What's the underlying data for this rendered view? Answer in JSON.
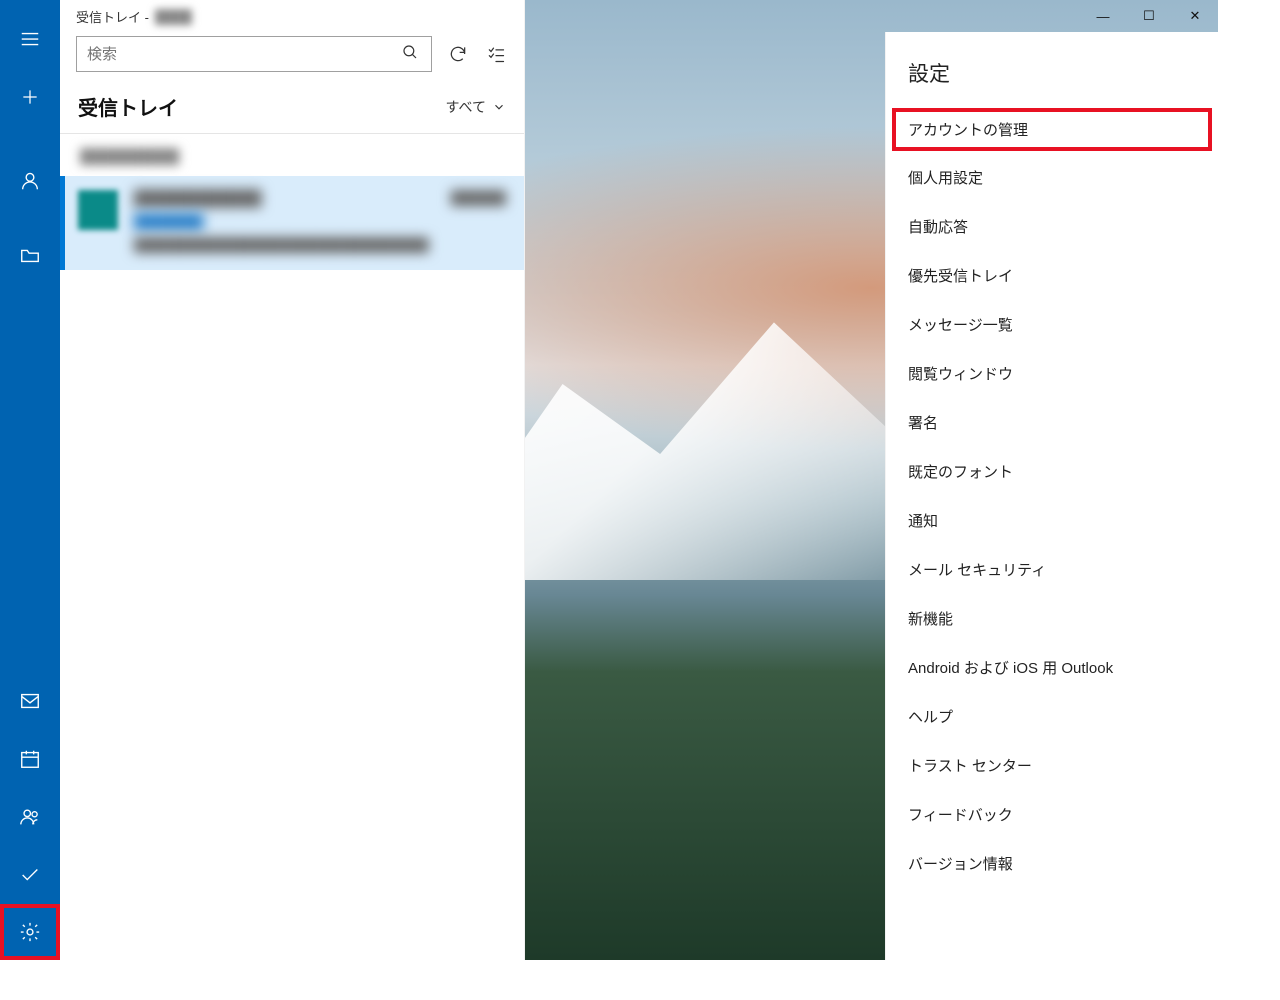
{
  "rail": {
    "items": [
      "menu",
      "compose",
      "account",
      "folder",
      "",
      "mail",
      "calendar",
      "people",
      "todo",
      "settings"
    ]
  },
  "titlebar": {
    "prefix": "受信トレイ -",
    "account": "████"
  },
  "search": {
    "placeholder": "検索"
  },
  "inbox": {
    "heading": "受信トレイ",
    "filter_label": "すべて"
  },
  "group": {
    "label": "██████████"
  },
  "mail": {
    "sender": "████████████",
    "date": "██████",
    "subject": "███████",
    "preview": "████████████████████████████████"
  },
  "window": {
    "minimize": "—",
    "maximize": "☐",
    "close": "✕"
  },
  "settings": {
    "title": "設定",
    "items": [
      "アカウントの管理",
      "個人用設定",
      "自動応答",
      "優先受信トレイ",
      "メッセージ一覧",
      "閲覧ウィンドウ",
      "署名",
      "既定のフォント",
      "通知",
      "メール セキュリティ",
      "新機能",
      "Android および iOS 用 Outlook",
      "ヘルプ",
      "トラスト センター",
      "フィードバック",
      "バージョン情報"
    ],
    "highlight_index": 0
  }
}
